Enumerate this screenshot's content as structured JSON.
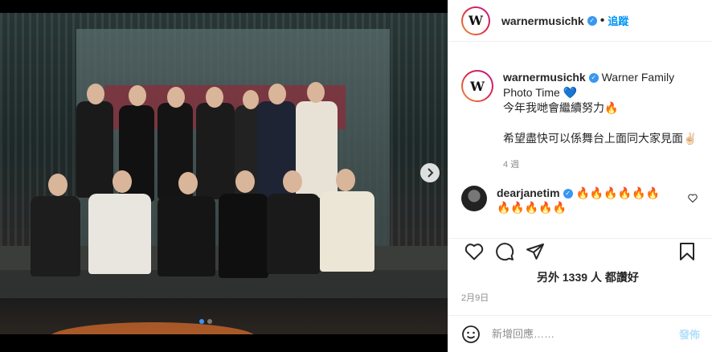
{
  "post": {
    "username": "warnermusichk",
    "avatar_letter": "W",
    "follow_label": "追蹤",
    "separator": "•",
    "caption": {
      "line1": "Warner Family",
      "line2": "Photo Time",
      "line2_emoji": "💙",
      "line3": "今年我哋會繼續努力🔥",
      "line4": "希望盡快可以係舞台上面同大家見面✌🏻",
      "time": "4 週"
    },
    "comment": {
      "username": "dearjanetim",
      "text": "🔥🔥🔥🔥🔥🔥🔥🔥🔥🔥🔥"
    },
    "likes_text": "另外 1339 人 都讚好",
    "date": "2月9日",
    "comment_placeholder": "新增回應……",
    "post_button": "發佈",
    "carousel_dots": 2,
    "active_dot": 0
  },
  "icons": {
    "verified": "verified-badge-icon",
    "heart": "heart-icon",
    "comment": "comment-icon",
    "share": "share-icon",
    "bookmark": "bookmark-icon",
    "emoji": "emoji-icon",
    "next": "chevron-right-icon"
  },
  "colors": {
    "link_blue": "#0095f6",
    "verified_blue": "#3897f0",
    "post_button_disabled": "#b2dffc",
    "muted": "#8e8e8e"
  }
}
